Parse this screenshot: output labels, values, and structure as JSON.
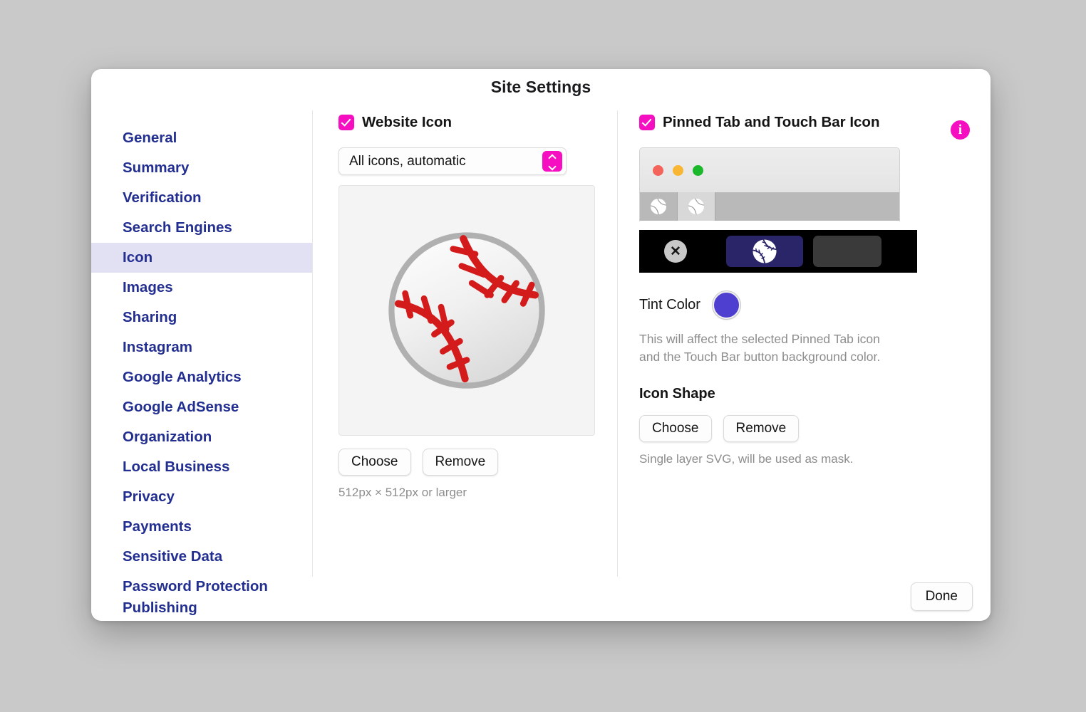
{
  "dialog": {
    "title": "Site Settings",
    "done_label": "Done"
  },
  "sidebar": {
    "items": [
      {
        "label": "General",
        "selected": false
      },
      {
        "label": "Summary",
        "selected": false
      },
      {
        "label": "Verification",
        "selected": false
      },
      {
        "label": "Search Engines",
        "selected": false
      },
      {
        "label": "Icon",
        "selected": true
      },
      {
        "label": "Images",
        "selected": false
      },
      {
        "label": "Sharing",
        "selected": false
      },
      {
        "label": "Instagram",
        "selected": false
      },
      {
        "label": "Google Analytics",
        "selected": false
      },
      {
        "label": "Google AdSense",
        "selected": false
      },
      {
        "label": "Organization",
        "selected": false
      },
      {
        "label": "Local Business",
        "selected": false
      },
      {
        "label": "Privacy",
        "selected": false
      },
      {
        "label": "Payments",
        "selected": false
      },
      {
        "label": "Sensitive Data",
        "selected": false
      },
      {
        "label": "Password Protection",
        "selected": false
      },
      {
        "label": "Publishing",
        "selected": false
      }
    ]
  },
  "website_icon": {
    "checkbox_label": "Website Icon",
    "checked": true,
    "select_value": "All icons, automatic",
    "choose_label": "Choose",
    "remove_label": "Remove",
    "caption": "512px × 512px or larger",
    "preview_icon": "baseball-icon"
  },
  "pinned_tab": {
    "checkbox_label": "Pinned Tab and Touch Bar Icon",
    "checked": true,
    "info_icon": "info-icon",
    "info_glyph": "i",
    "window_preview": {
      "traffic_lights": [
        "close-red",
        "minimize-yellow",
        "zoom-green"
      ],
      "tabs": [
        {
          "icon": "baseball-icon",
          "active": false
        },
        {
          "icon": "baseball-icon",
          "active": true
        }
      ]
    },
    "touch_bar": {
      "close_glyph": "✕",
      "tinted_button_icon": "baseball-icon",
      "tinted_button_color": "#2a2469"
    },
    "tint": {
      "label": "Tint Color",
      "color": "#4f3fd0",
      "description": "This will affect the selected Pinned Tab icon and the Touch Bar button background color."
    },
    "icon_shape": {
      "title": "Icon Shape",
      "choose_label": "Choose",
      "remove_label": "Remove",
      "caption": "Single layer SVG, will be used as mask."
    }
  },
  "colors": {
    "accent": "#f50fc0",
    "sidebar_text": "#232f90",
    "sidebar_selected_bg": "#e2e0f3",
    "tint": "#4f3fd0"
  }
}
